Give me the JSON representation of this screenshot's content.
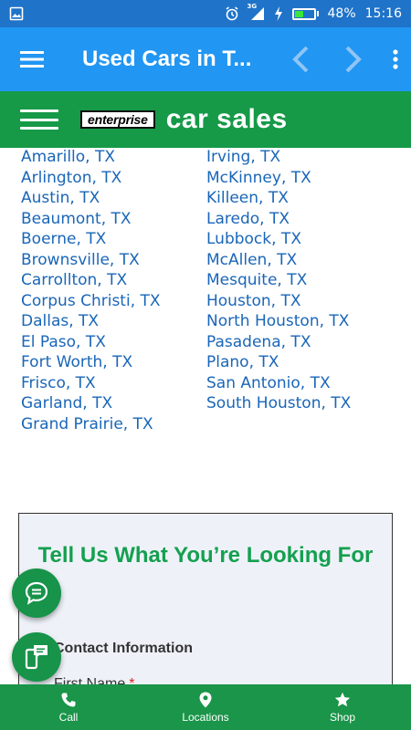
{
  "status_bar": {
    "network": "3G",
    "battery_percent": "48%",
    "battery_level": 0.48,
    "time": "15:16",
    "colors": {
      "bar": "#1f73c9",
      "battery_fill": "#39e639"
    }
  },
  "app_bar": {
    "title": "Used Cars in T...",
    "icons": [
      "menu-icon",
      "back-arrow-icon",
      "forward-arrow-icon",
      "more-vert-icon"
    ],
    "color": "#2196f3"
  },
  "site_header": {
    "logo_badge": "enterprise",
    "logo_text": "car sales",
    "color": "#169a48"
  },
  "cities": {
    "left": [
      "Amarillo, TX",
      "Arlington, TX",
      "Austin, TX",
      "Beaumont, TX",
      "Boerne, TX",
      "Brownsville, TX",
      "Carrollton, TX",
      "Corpus Christi, TX",
      "Dallas, TX",
      "El Paso, TX",
      "Fort Worth, TX",
      "Frisco, TX",
      "Garland, TX",
      "Grand Prairie, TX"
    ],
    "right": [
      "Irving, TX",
      "McKinney, TX",
      "Killeen, TX",
      "Laredo, TX",
      "Lubbock, TX",
      "McAllen, TX",
      "Mesquite, TX",
      "Houston, TX",
      "North Houston, TX",
      "Pasadena, TX",
      "Plano, TX",
      "San Antonio, TX",
      "South Houston, TX"
    ],
    "link_color": "#1a66b8"
  },
  "form": {
    "heading": "Tell Us What You’re Looking For",
    "section": "Contact Information",
    "first_name_label": "First Name",
    "required_mark": "*",
    "heading_color": "#14a04f"
  },
  "fabs": [
    {
      "icon": "chat-icon"
    },
    {
      "icon": "sms-phone-icon"
    }
  ],
  "bottom_nav": {
    "items": [
      {
        "label": "Call",
        "icon": "phone-icon"
      },
      {
        "label": "Locations",
        "icon": "location-pin-icon"
      },
      {
        "label": "Shop",
        "icon": "star-icon"
      }
    ],
    "color": "#1a9549"
  }
}
